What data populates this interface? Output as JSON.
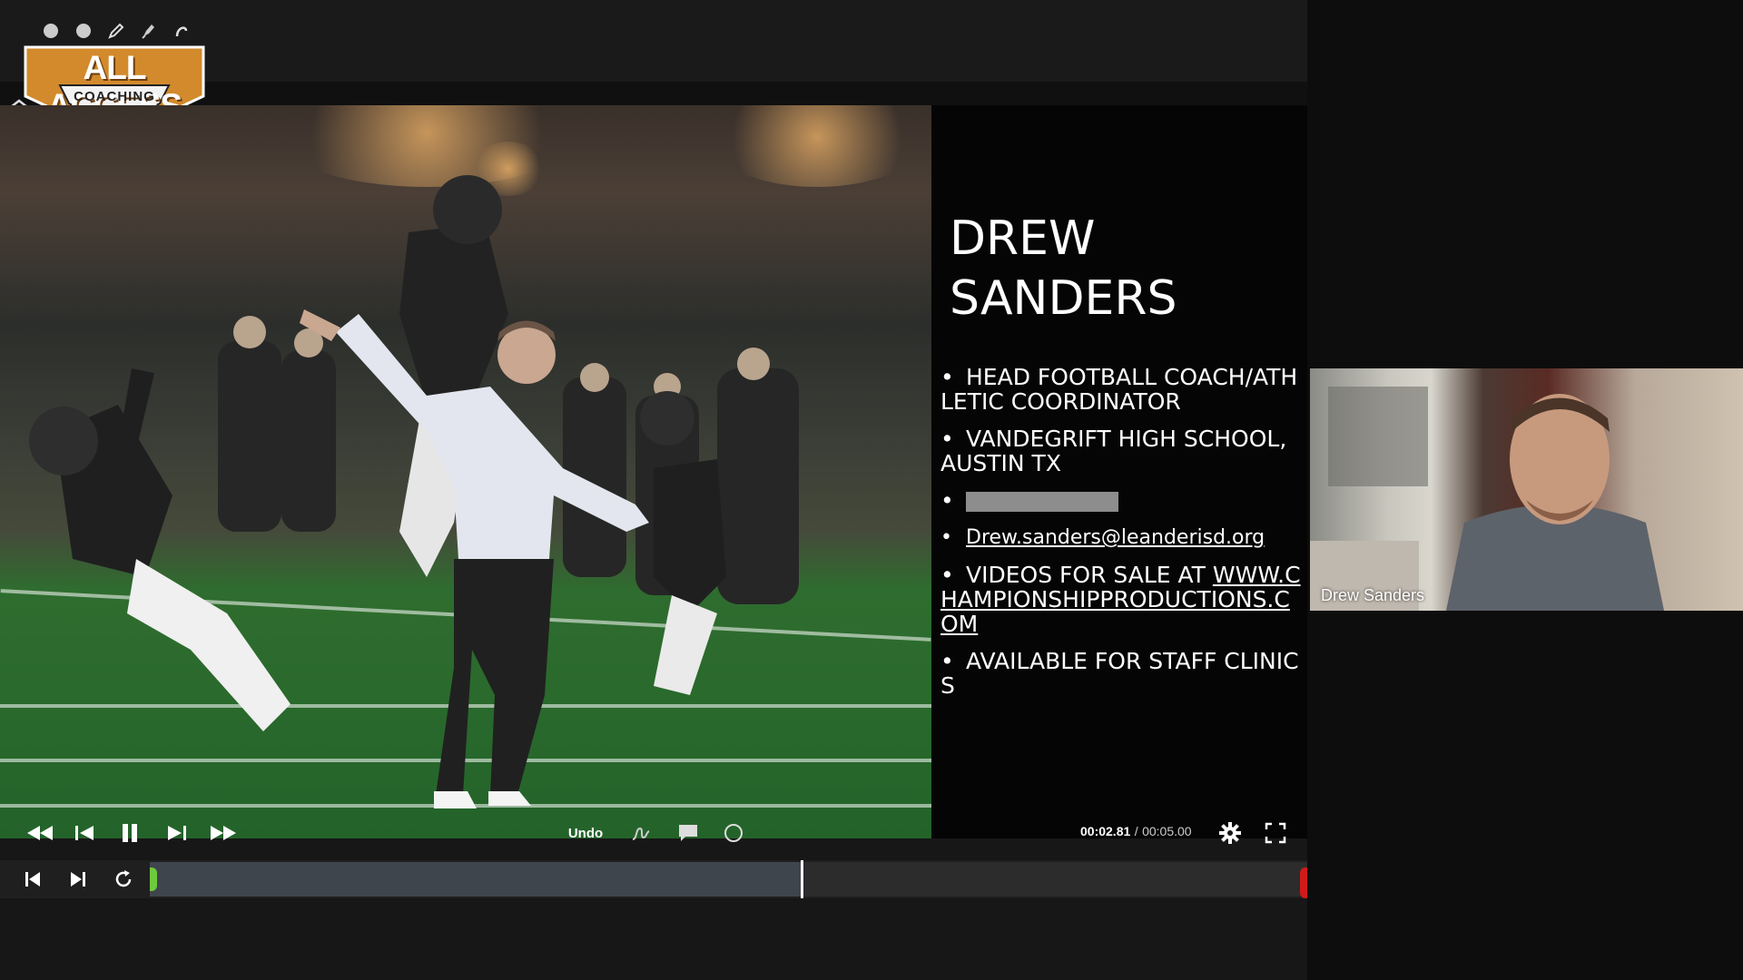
{
  "logo": {
    "title": "ALL ACCESS",
    "subtitle": "COACHING"
  },
  "tools": [
    "circle-icon",
    "circle-icon",
    "pencil-icon",
    "marker-icon",
    "eraser-icon"
  ],
  "slide": {
    "title": "DREW\nSANDERS",
    "bullets": [
      "HEAD FOOTBALL COACH/ATHLETIC COORDINATOR",
      "VANDEGRIFT HIGH SCHOOL, AUSTIN TX",
      "",
      "Drew.sanders@leanderisd.org",
      "VIDEOS FOR SALE AT ",
      "AVAILABLE FOR STAFF CLINICS"
    ],
    "link_text": "WWW.CHAMPIONSHIPPRODUCTIONS.COM"
  },
  "controls": {
    "undo_label": "Undo",
    "time_current": "00:02.81",
    "time_separator": "/",
    "time_total": "00:05.00"
  },
  "timeline": {
    "progress": 0.562
  },
  "webcam": {
    "name": "Drew Sanders"
  },
  "colors": {
    "accent_orange": "#d28a2c",
    "timeline_start": "#6ec93c",
    "timeline_end": "#d11a1a"
  }
}
